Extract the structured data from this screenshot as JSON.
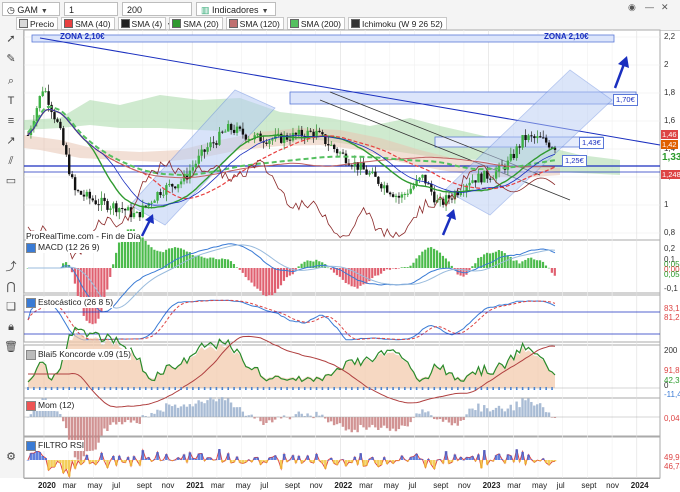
{
  "toolbar": {
    "symbol": "GAM",
    "period": "1 semana",
    "units": "200 unidades",
    "indicators": "Indicadores",
    "legend": [
      {
        "label": "Precio",
        "color": "#d8d8d8"
      },
      {
        "label": "SMA (40)",
        "color": "#e84040"
      },
      {
        "label": "SMA (4)",
        "color": "#222222"
      },
      {
        "label": "SMA (20)",
        "color": "#2f9a2f"
      },
      {
        "label": "SMA (120)",
        "color": "#c07070"
      },
      {
        "label": "SMA (200)",
        "color": "#55c060"
      },
      {
        "label": "Ichimoku (W 9 26 52)",
        "color": "#333333"
      }
    ]
  },
  "panels": {
    "source": "ProRealTime.com - Fin de Día",
    "macd": "MACD (12 26 9)",
    "stoch": "Estocástico (26 8 5)",
    "koncorde": "Blai5 Koncorde v.09 (15)",
    "mom": "Mom (12)",
    "rsi": "FILTRO RSI"
  },
  "annotations": {
    "zona_left": "ZONA 2,10€",
    "zona_right": "ZONA 2,10€",
    "box_170": "1,70€",
    "box_143": "1,43€",
    "box_125": "1,25€"
  },
  "price_axis": {
    "ticks": [
      "2,2",
      "2",
      "1,8",
      "1,6",
      "1,4",
      "1,2",
      "1",
      "0,8"
    ]
  },
  "right_tags": [
    {
      "text": "1,46",
      "color": "#d44"
    },
    {
      "text": "1,42",
      "color": "#e06000"
    },
    {
      "text": "1,33",
      "color": "#2a9a2a"
    },
    {
      "text": "1,248",
      "color": "#d44"
    }
  ],
  "macd_axis": [
    "0,2",
    "0,1",
    "0,050",
    "0,000",
    "0,052",
    "-0,1"
  ],
  "stoch_axis": [
    "83,16",
    "81,27"
  ],
  "koncorde_axis": [
    "200",
    "91,88",
    "42,38",
    "0",
    "-11,42"
  ],
  "mom_axis": [
    "0,040"
  ],
  "rsi_axis": [
    "49,91",
    "46,74"
  ],
  "xaxis": [
    {
      "t": "2020",
      "yr": true
    },
    {
      "t": "mar"
    },
    {
      "t": "may"
    },
    {
      "t": "jul"
    },
    {
      "t": "sept"
    },
    {
      "t": "nov"
    },
    {
      "t": "2021",
      "yr": true
    },
    {
      "t": "mar"
    },
    {
      "t": "may"
    },
    {
      "t": "jul"
    },
    {
      "t": "sept"
    },
    {
      "t": "nov"
    },
    {
      "t": "2022",
      "yr": true
    },
    {
      "t": "mar"
    },
    {
      "t": "may"
    },
    {
      "t": "jul"
    },
    {
      "t": "sept"
    },
    {
      "t": "nov"
    },
    {
      "t": "2023",
      "yr": true
    },
    {
      "t": "mar"
    },
    {
      "t": "may"
    },
    {
      "t": "jul"
    },
    {
      "t": "sept"
    },
    {
      "t": "nov"
    },
    {
      "t": "2024",
      "yr": true
    }
  ],
  "chart_data": {
    "type": "candlestick",
    "symbol": "GAM",
    "timeframe": "1 semana",
    "ylim": [
      0.75,
      2.25
    ],
    "levels": [
      2.1,
      1.7,
      1.43,
      1.25
    ],
    "price_x": [
      2020.0,
      2020.1,
      2020.2,
      2020.3,
      2020.45,
      2020.6,
      2020.7,
      2020.85,
      2021.0,
      2021.15,
      2021.3,
      2021.45,
      2021.6,
      2021.75,
      2021.85,
      2022.0,
      2022.1,
      2022.25,
      2022.4,
      2022.55,
      2022.65,
      2022.75,
      2022.85,
      2023.0,
      2023.1,
      2023.2,
      2023.3,
      2023.4
    ],
    "price_close": [
      1.5,
      1.85,
      1.55,
      1.1,
      1.02,
      0.98,
      0.92,
      1.1,
      1.18,
      1.4,
      1.55,
      1.48,
      1.47,
      1.5,
      1.52,
      1.38,
      1.3,
      1.18,
      1.05,
      1.2,
      1.0,
      1.08,
      1.18,
      1.22,
      1.3,
      1.48,
      1.47,
      1.42
    ],
    "arrows": [
      "2020 sept",
      "2022 sept",
      "2023 jul"
    ]
  }
}
